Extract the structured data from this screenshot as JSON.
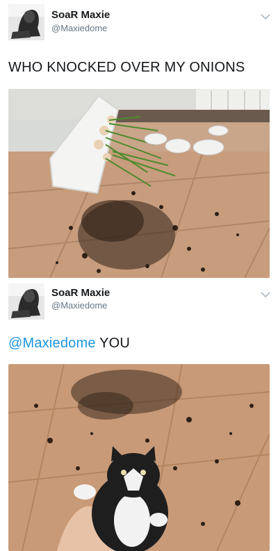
{
  "tweets": [
    {
      "author_name": "SoaR Maxie",
      "author_handle": "@Maxiedome",
      "text": "WHO KNOCKED OVER MY ONIONS",
      "avatar_icon": "avatar-photo-icon",
      "menu_icon": "chevron-down-icon"
    },
    {
      "author_name": "SoaR Maxie",
      "author_handle": "@Maxiedome",
      "mention": "@Maxiedome",
      "text_rest": " YOU",
      "avatar_icon": "avatar-photo-icon",
      "menu_icon": "chevron-down-icon"
    }
  ],
  "colors": {
    "name": "#14171a",
    "handle": "#657786",
    "mention": "#1b95e0",
    "chevron": "#aab8c2"
  }
}
